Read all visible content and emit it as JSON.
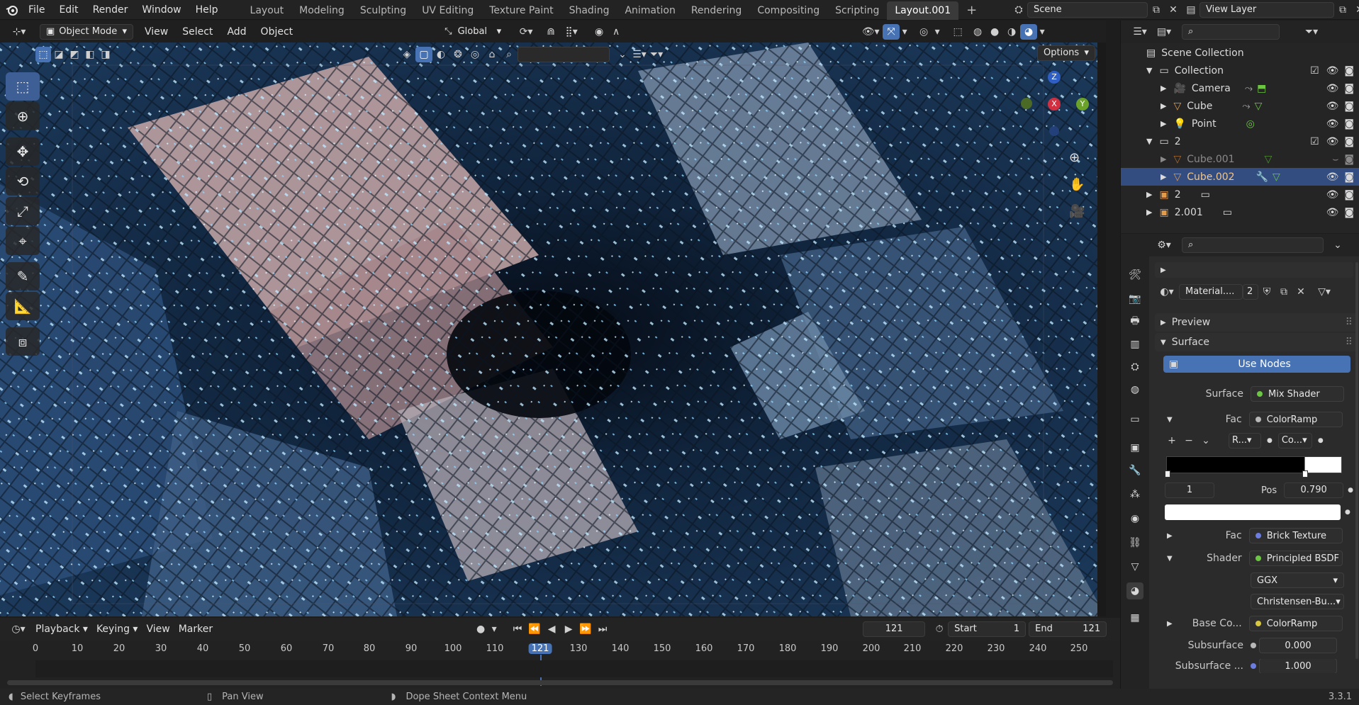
{
  "menu": {
    "items": [
      "File",
      "Edit",
      "Render",
      "Window",
      "Help"
    ]
  },
  "workspaces": {
    "tabs": [
      "Layout",
      "Modeling",
      "Sculpting",
      "UV Editing",
      "Texture Paint",
      "Shading",
      "Animation",
      "Rendering",
      "Compositing",
      "Scripting",
      "Layout.001"
    ],
    "active": "Layout.001",
    "add_label": "+"
  },
  "scene": {
    "name": "Scene"
  },
  "view_layer": {
    "name": "View Layer"
  },
  "viewport": {
    "mode": "Object Mode",
    "menus": [
      "View",
      "Select",
      "Add",
      "Object"
    ],
    "transform_orientation": "Global",
    "options_label": "Options",
    "gizmo": {
      "z": "Z",
      "x": "X",
      "y": "Y"
    }
  },
  "outliner": {
    "root": "Scene Collection",
    "rows": [
      {
        "label": "Collection",
        "kind": "collection"
      },
      {
        "label": "Camera",
        "kind": "camera"
      },
      {
        "label": "Cube",
        "kind": "mesh"
      },
      {
        "label": "Point",
        "kind": "light"
      },
      {
        "label": "2",
        "kind": "collection"
      },
      {
        "label": "Cube.001",
        "kind": "mesh"
      },
      {
        "label": "Cube.002",
        "kind": "mesh"
      },
      {
        "label": "2",
        "kind": "collection-instance"
      },
      {
        "label": "2.001",
        "kind": "collection-instance"
      }
    ],
    "selected": "Cube.002"
  },
  "properties": {
    "material_name": "Material....",
    "material_users": "2",
    "panels": {
      "preview": "Preview",
      "surface": "Surface"
    },
    "use_nodes_label": "Use Nodes",
    "surface_label": "Surface",
    "surface_value": "Mix Shader",
    "fac_label": "Fac",
    "fac_value": "ColorRamp",
    "ramp_interp": "R...",
    "ramp_mode": "Co...",
    "ramp_index": "1",
    "pos_label": "Pos",
    "pos_value": "0.790",
    "fac2_label": "Fac",
    "fac2_value": "Brick Texture",
    "shader_label": "Shader",
    "shader_value": "Principled BSDF",
    "distribution": "GGX",
    "subsurface_method": "Christensen-Bu...",
    "base_color_label": "Base Co...",
    "base_color_value": "ColorRamp",
    "subsurface_label": "Subsurface",
    "subsurface_value": "0.000",
    "subsurface2_label": "Subsurface ...",
    "subsurface2_value": "1.000"
  },
  "timeline": {
    "menus": [
      "Playback",
      "Keying",
      "View",
      "Marker"
    ],
    "current_frame": "121",
    "start_label": "Start",
    "start": "1",
    "end_label": "End",
    "end": "121",
    "ticks": [
      "0",
      "10",
      "20",
      "30",
      "40",
      "50",
      "60",
      "70",
      "80",
      "90",
      "100",
      "110",
      "121",
      "130",
      "140",
      "150",
      "160",
      "170",
      "180",
      "190",
      "200",
      "210",
      "220",
      "230",
      "240",
      "250"
    ]
  },
  "status": {
    "select": "Select Keyframes",
    "pan": "Pan View",
    "context": "Dope Sheet Context Menu",
    "version": "3.3.1"
  },
  "colors": {
    "accent": "#4772b3",
    "selection": "#334d80",
    "material_dot": "#6cc644",
    "texture_dot": "#6b7de0",
    "color_dot": "#d7c640"
  }
}
